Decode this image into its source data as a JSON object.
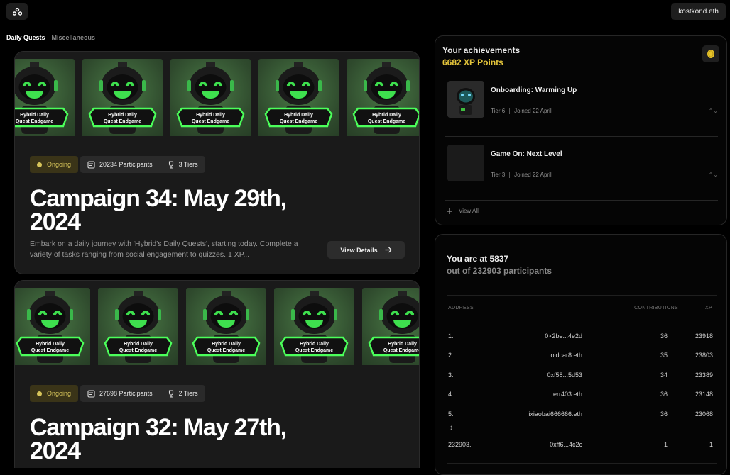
{
  "header": {
    "logo_icon": "hybrid-logo-icon",
    "user_label": "kostkond.eth"
  },
  "tabs": [
    {
      "label": "Daily Quests",
      "active": true
    },
    {
      "label": "Miscellaneous",
      "active": false
    }
  ],
  "campaigns": [
    {
      "thumb_label": "Hybrid Daily\nQuest Endgame",
      "status": "Ongoing",
      "participants": "20234 Participants",
      "tiers": "3 Tiers",
      "title": "Campaign 34: May 29th, 2024",
      "description": "Embark on a daily journey with 'Hybrid's Daily Quests', starting today. Complete a variety of tasks ranging from social engagement to quizzes. 1 XP...",
      "button_label": "View Details"
    },
    {
      "thumb_label": "Hybrid Daily\nQuest Endgame",
      "status": "Ongoing",
      "participants": "27698 Participants",
      "tiers": "2 Tiers",
      "title": "Campaign 32: May 27th, 2024"
    }
  ],
  "achievements": {
    "title": "Your achievements",
    "xp_points": "6682 XP Points",
    "coin_icon": "coin-icon",
    "items": [
      {
        "name": "Onboarding: Warming Up",
        "tier": "Tier  6",
        "joined": "Joined  22 April"
      },
      {
        "name": "Game On: Next Level",
        "tier": "Tier  3",
        "joined": "Joined  22 April"
      }
    ],
    "view_all": "View All"
  },
  "leaderboard": {
    "rank_text": "You are at 5837",
    "total_text": "out of 232903 participants",
    "headers": {
      "address": "ADDRESS",
      "contributions": "CONTRIBUTIONS",
      "xp": "XP"
    },
    "rows": [
      {
        "num": "1.",
        "address": "0×2be...4e2d",
        "contributions": "36",
        "xp": "23918"
      },
      {
        "num": "2.",
        "address": "oldcar8.eth",
        "contributions": "35",
        "xp": "23803"
      },
      {
        "num": "3.",
        "address": "0xf58...5d53",
        "contributions": "34",
        "xp": "23389"
      },
      {
        "num": "4.",
        "address": "err403.eth",
        "contributions": "36",
        "xp": "23148"
      },
      {
        "num": "5.",
        "address": "lixiaobai666666.eth",
        "contributions": "36",
        "xp": "23068"
      }
    ],
    "more_symbol": "↕",
    "user_row": {
      "num": "232903.",
      "address": "0xff6...4c2c",
      "contributions": "1",
      "xp": "1"
    }
  }
}
